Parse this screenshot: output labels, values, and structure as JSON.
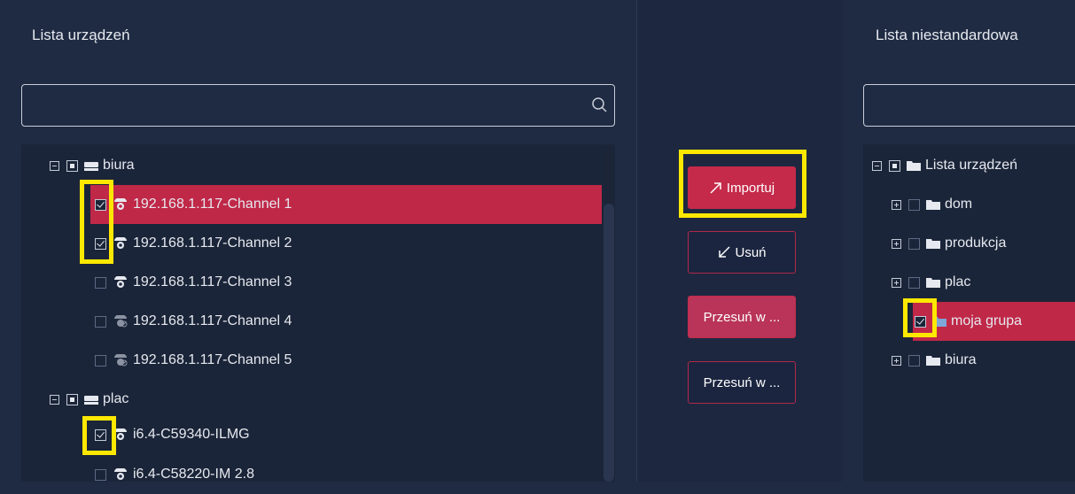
{
  "left_panel": {
    "title": "Lista urządzeń",
    "search": {
      "value": "",
      "placeholder": ""
    },
    "tree": [
      {
        "label": "biura",
        "type": "group",
        "expanded": true,
        "check": "partial"
      },
      {
        "label": "192.168.1.117-Channel 1",
        "type": "camera",
        "check": "checked",
        "selected": true
      },
      {
        "label": "192.168.1.117-Channel 2",
        "type": "camera",
        "check": "checked"
      },
      {
        "label": "192.168.1.117-Channel 3",
        "type": "camera",
        "check": "unchecked"
      },
      {
        "label": "192.168.1.117-Channel 4",
        "type": "camera-offline",
        "check": "unchecked"
      },
      {
        "label": "192.168.1.117-Channel 5",
        "type": "camera-offline",
        "check": "unchecked"
      },
      {
        "label": "plac",
        "type": "group",
        "expanded": true,
        "check": "partial"
      },
      {
        "label": "i6.4-C59340-ILMG",
        "type": "camera",
        "check": "checked"
      },
      {
        "label": "i6.4-C58220-IM 2.8",
        "type": "camera",
        "check": "unchecked"
      }
    ]
  },
  "actions": {
    "import_label": "Importuj",
    "remove_label": "Usuń",
    "move_up_label": "Przesuń w ...",
    "move_down_label": "Przesuń w ..."
  },
  "right_panel": {
    "title": "Lista niestandardowa",
    "search": {
      "value": "",
      "placeholder": ""
    },
    "tree": [
      {
        "label": "Lista urządzeń",
        "type": "folder",
        "expanded": true,
        "check": "partial"
      },
      {
        "label": "dom",
        "type": "folder",
        "expanded": false,
        "check": "unchecked"
      },
      {
        "label": "produkcja",
        "type": "folder",
        "expanded": false,
        "check": "unchecked"
      },
      {
        "label": "plac",
        "type": "folder",
        "expanded": false,
        "check": "unchecked"
      },
      {
        "label": "moja grupa",
        "type": "folder",
        "check": "checked",
        "selected": true
      },
      {
        "label": "biura",
        "type": "folder",
        "expanded": false,
        "check": "unchecked"
      }
    ]
  },
  "colors": {
    "background": "#1f2b43",
    "accent": "#c52a4a",
    "highlight": "#ffe800"
  }
}
